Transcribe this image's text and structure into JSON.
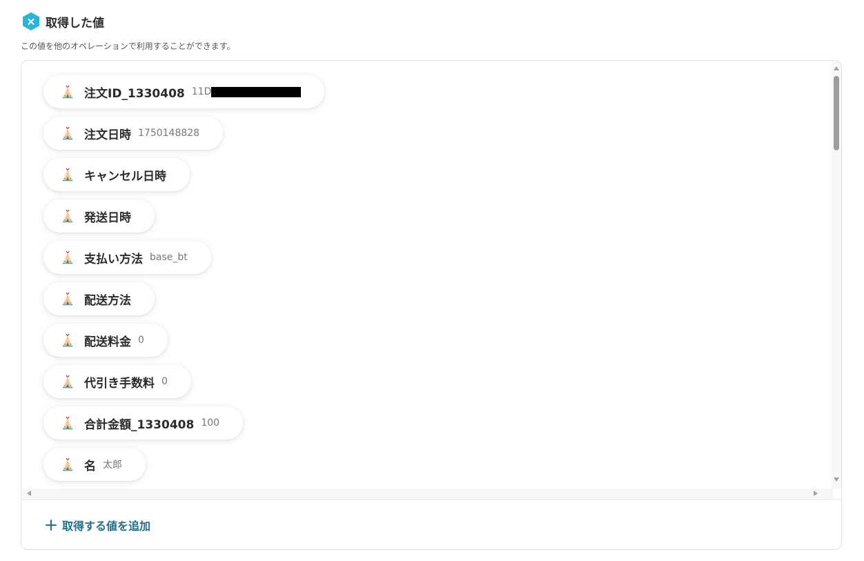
{
  "section": {
    "title": "取得した値",
    "description": "この値を他のオペレーションで利用することができます。",
    "icon": "x-hexagon-icon",
    "icon_color": "#2ab4d9"
  },
  "items": [
    {
      "label": "注文ID_1330408",
      "value": "11D",
      "redacted": true
    },
    {
      "label": "注文日時",
      "value": "1750148828"
    },
    {
      "label": "キャンセル日時",
      "value": ""
    },
    {
      "label": "発送日時",
      "value": ""
    },
    {
      "label": "支払い方法",
      "value": "base_bt"
    },
    {
      "label": "配送方法",
      "value": ""
    },
    {
      "label": "配送料金",
      "value": "0"
    },
    {
      "label": "代引き手数料",
      "value": "0"
    },
    {
      "label": "合計金額_1330408",
      "value": "100"
    },
    {
      "label": "名",
      "value": "太郎"
    }
  ],
  "item_icon": "tipi-icon",
  "add_button": {
    "label": "取得する値を追加",
    "icon": "plus-icon",
    "color": "#1f6f86"
  }
}
